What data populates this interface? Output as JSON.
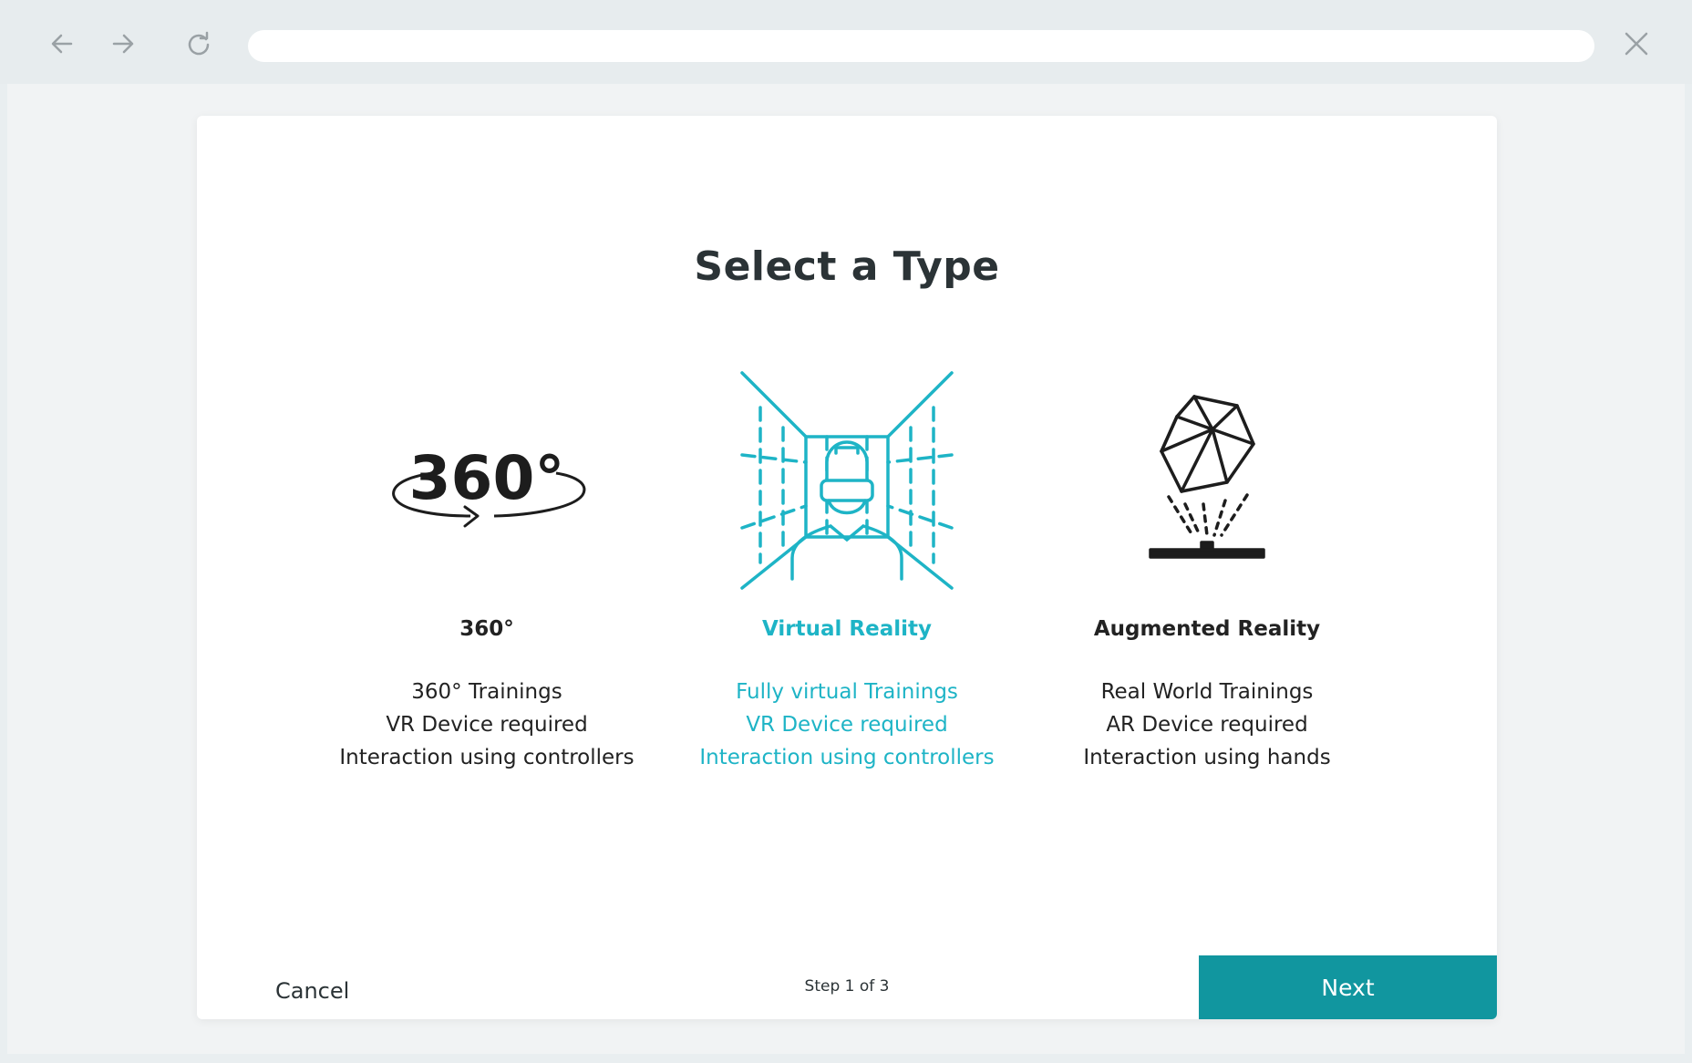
{
  "browser": {
    "back_icon": "arrow-left-icon",
    "forward_icon": "arrow-right-icon",
    "reload_icon": "reload-icon",
    "close_icon": "close-icon",
    "url": ""
  },
  "dialog": {
    "title": "Select a Type",
    "options": [
      {
        "title": "360°",
        "icon": "360-rotation-icon",
        "lines": [
          "360° Trainings",
          "VR Device required",
          "Interaction using controllers"
        ],
        "selected": false
      },
      {
        "title": "Virtual Reality",
        "icon": "vr-headset-room-icon",
        "lines": [
          "Fully virtual Trainings",
          "VR Device required",
          "Interaction using controllers"
        ],
        "selected": true
      },
      {
        "title": "Augmented Reality",
        "icon": "ar-hologram-icon",
        "lines": [
          "Real World Trainings",
          "AR Device required",
          "Interaction using hands"
        ],
        "selected": false
      }
    ],
    "footer": {
      "cancel_label": "Cancel",
      "step_text": "Step 1 of 3",
      "next_label": "Next"
    }
  },
  "colors": {
    "accent": "#1eb4c6",
    "primary_button": "#11969f",
    "text": "#2b3336"
  }
}
